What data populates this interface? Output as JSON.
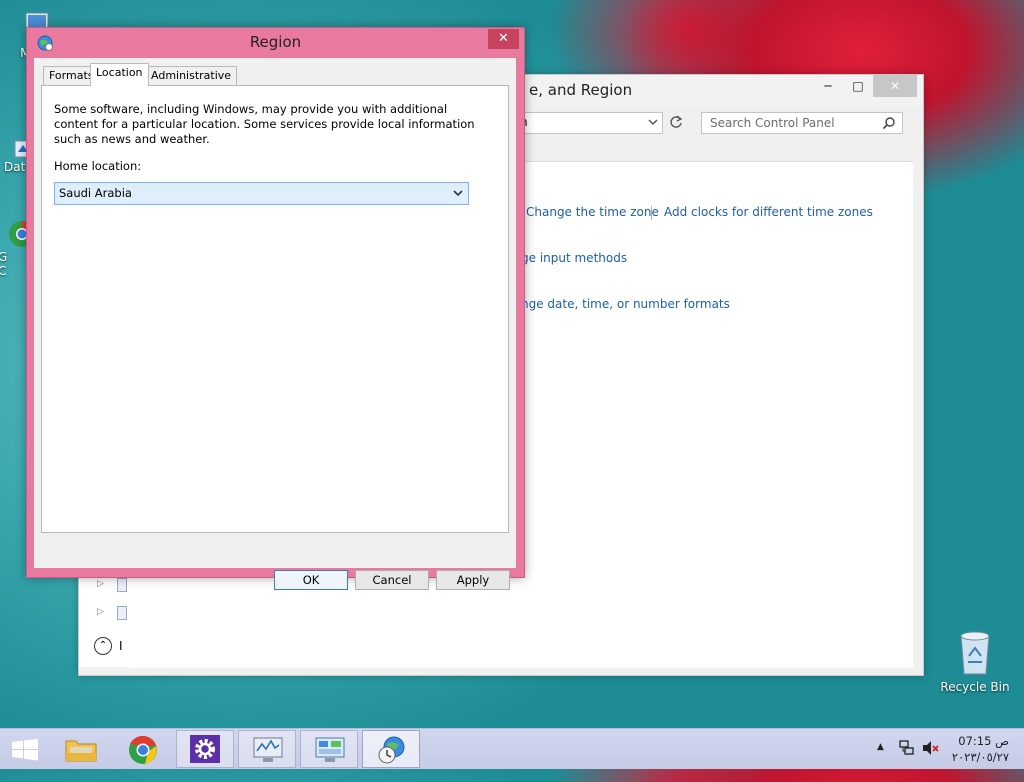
{
  "desktop": {
    "icons": [
      {
        "label": "My C",
        "icon": "computer-icon"
      },
      {
        "label": "Data",
        "icon": "data-icon"
      },
      {
        "label": "G",
        "icon": "chrome-icon"
      },
      {
        "label": "C",
        "icon": "chrome-icon"
      },
      {
        "label": "Recycle Bin",
        "icon": "recycle-bin-icon"
      }
    ]
  },
  "control_panel": {
    "title": "e, and Region",
    "address_text": "n",
    "search_placeholder": "Search Control Panel",
    "links": {
      "change_time_zone": "Change the time zone",
      "add_clocks": "Add clocks for different time zones",
      "input_methods": "ge input methods",
      "formats": "nge date, time, or number formats"
    },
    "buttons": {
      "minimize": "─",
      "maximize": "□",
      "close": "✕"
    },
    "left_panel": {
      "expand_1": "▷",
      "expand_2": "▷",
      "up": "⌃",
      "up_text": "I"
    }
  },
  "region_dialog": {
    "title": "Region",
    "close": "✕",
    "tabs": [
      {
        "label": "Formats",
        "active": false
      },
      {
        "label": "Location",
        "active": true
      },
      {
        "label": "Administrative",
        "active": false
      }
    ],
    "description": "Some software, including Windows, may provide you with additional content for a particular location. Some services provide local information such as news and weather.",
    "home_location_label": "Home location:",
    "home_location_value": "Saudi Arabia",
    "buttons": {
      "ok": "OK",
      "cancel": "Cancel",
      "apply": "Apply"
    }
  },
  "taskbar": {
    "items": [
      {
        "name": "start",
        "icon": "windows-icon",
        "state": "none"
      },
      {
        "name": "file-explorer",
        "icon": "folder-icon",
        "state": "none"
      },
      {
        "name": "chrome",
        "icon": "chrome-icon",
        "state": "none"
      },
      {
        "name": "settings",
        "icon": "gear-icon",
        "state": "open"
      },
      {
        "name": "performance",
        "icon": "monitor-icon",
        "state": "open"
      },
      {
        "name": "control-panel",
        "icon": "control-panel-icon",
        "state": "open"
      },
      {
        "name": "region",
        "icon": "globe-clock-icon",
        "state": "active"
      }
    ],
    "tray": {
      "chevron": "▲",
      "time": "07:15 ص",
      "date": "٢٠٢٣/٠٥/٢٧"
    }
  },
  "colors": {
    "dialog_frame": "#e9799e",
    "link": "#1e5fa6",
    "selected_field": "#dfeefb"
  }
}
